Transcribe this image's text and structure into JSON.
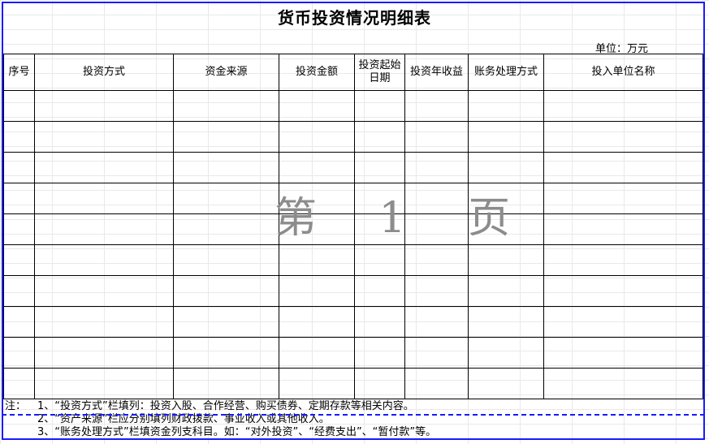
{
  "title": "货币投资情况明细表",
  "unit_label": "单位：万元",
  "columns": [
    "序号",
    "投资方式",
    "资金来源",
    "投资金额",
    "投资起始日期",
    "投资年收益",
    "账务处理方式",
    "投入单位名称"
  ],
  "column_lines": {
    "start_date_line1": "投资起始",
    "start_date_line2": "日期"
  },
  "rows": [
    [
      "",
      "",
      "",
      "",
      "",
      "",
      "",
      ""
    ],
    [
      "",
      "",
      "",
      "",
      "",
      "",
      "",
      ""
    ],
    [
      "",
      "",
      "",
      "",
      "",
      "",
      "",
      ""
    ],
    [
      "",
      "",
      "",
      "",
      "",
      "",
      "",
      ""
    ],
    [
      "",
      "",
      "",
      "",
      "",
      "",
      "",
      ""
    ],
    [
      "",
      "",
      "",
      "",
      "",
      "",
      "",
      ""
    ],
    [
      "",
      "",
      "",
      "",
      "",
      "",
      "",
      ""
    ],
    [
      "",
      "",
      "",
      "",
      "",
      "",
      "",
      ""
    ],
    [
      "",
      "",
      "",
      "",
      "",
      "",
      "",
      ""
    ],
    [
      "",
      "",
      "",
      "",
      "",
      "",
      "",
      ""
    ]
  ],
  "watermark": "第 1 页",
  "notes": {
    "prefix": "注：",
    "items": [
      "1、“投资方式”栏填列：投资入股、合作经营、购买债券、定期存款等相关内容。",
      "2、“资产来源”栏应分别填列财政拨款、事业收入或其他收入。",
      "3、“账务处理方式”栏填资金列支科目。如：“对外投资”、“经费支出”、“暂付款”等。"
    ]
  },
  "colors": {
    "page_border": "#1a1aff",
    "watermark": "#8c8c8c"
  }
}
